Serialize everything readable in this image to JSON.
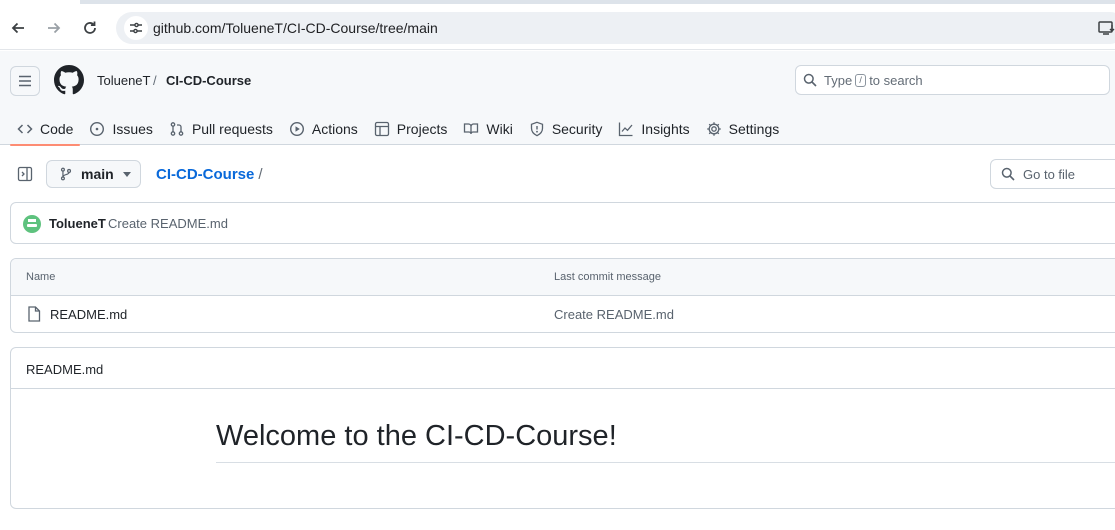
{
  "browser": {
    "url": "github.com/TolueneT/CI-CD-Course/tree/main",
    "icons": [
      "back-icon",
      "forward-icon",
      "reload-icon",
      "site-info-icon",
      "download-icon"
    ]
  },
  "header": {
    "owner": "TolueneT",
    "separator": "/",
    "repo": "CI-CD-Course",
    "search": {
      "prefix": "Type",
      "key": "/",
      "suffix": "to search"
    }
  },
  "repo_nav": {
    "code": "Code",
    "issues": "Issues",
    "pull_requests": "Pull requests",
    "actions": "Actions",
    "projects": "Projects",
    "wiki": "Wiki",
    "security": "Security",
    "insights": "Insights",
    "settings": "Settings",
    "selected": "Code",
    "accent_color": "#fd8c73"
  },
  "file_browser": {
    "branch": "main",
    "path_repo": "CI-CD-Course",
    "path_sep": "/",
    "goto_placeholder": "Go to file"
  },
  "latest_commit": {
    "author": "TolueneT",
    "message": "Create README.md"
  },
  "files": {
    "columns": [
      "Name",
      "Last commit message"
    ],
    "rows": [
      {
        "name": "README.md",
        "message": "Create README.md"
      }
    ]
  },
  "readme": {
    "title": "README.md",
    "heading": "Welcome to the CI-CD-Course!"
  },
  "colors": {
    "link": "#0969da",
    "border": "#d0d7de",
    "avatar": "#5ec27e"
  }
}
